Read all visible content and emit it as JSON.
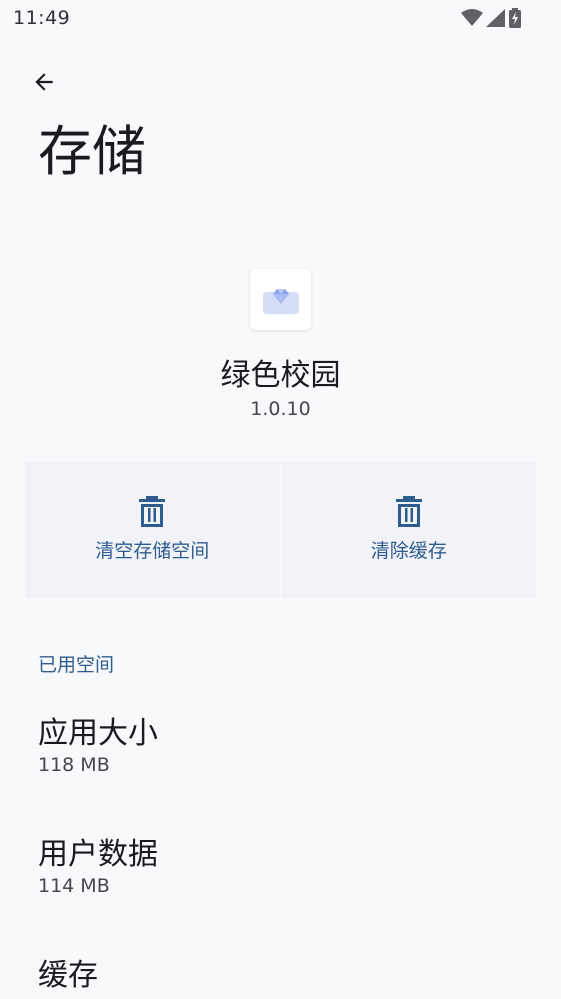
{
  "status_bar": {
    "time": "11:49"
  },
  "header": {
    "back_label": "back",
    "title": "存储"
  },
  "app": {
    "name": "绿色校园",
    "version": "1.0.10",
    "icon": "diamond-app-icon"
  },
  "actions": [
    {
      "label": "清空存储空间",
      "icon": "trash-icon"
    },
    {
      "label": "清除缓存",
      "icon": "trash-icon"
    }
  ],
  "section": {
    "title": "已用空间"
  },
  "items": [
    {
      "title": "应用大小",
      "value": "118 MB"
    },
    {
      "title": "用户数据",
      "value": "114 MB"
    },
    {
      "title": "缓存",
      "value": ""
    }
  ],
  "colors": {
    "accent": "#2f5c8f",
    "background": "#f8f9fb",
    "button_bg": "#f1f3f8"
  }
}
